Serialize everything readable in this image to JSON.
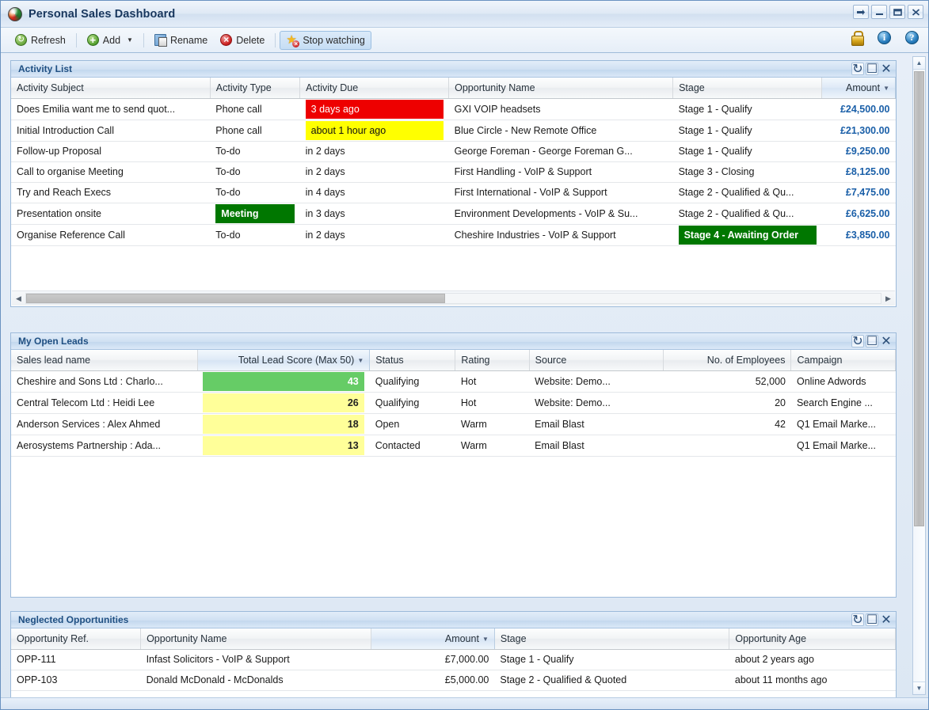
{
  "window": {
    "title": "Personal Sales Dashboard",
    "app_icon": "globe-icon",
    "controls": [
      {
        "name": "restore-down-button",
        "glyph": "⇥"
      },
      {
        "name": "minimize-button",
        "glyph": "─"
      },
      {
        "name": "maximize-button",
        "glyph": "☐"
      },
      {
        "name": "close-button",
        "glyph": "✕"
      }
    ]
  },
  "toolbar": {
    "refresh_label": "Refresh",
    "add_label": "Add",
    "add_caret": "▼",
    "rename_label": "Rename",
    "delete_label": "Delete",
    "stop_watching_label": "Stop watching",
    "right_icons": [
      "lock-icon",
      "info-icon",
      "help-icon"
    ],
    "info_glyph": "i",
    "help_glyph": "?"
  },
  "panel_buttons": {
    "refresh": "↻",
    "maximize": "☐",
    "close": "✕"
  },
  "panels": {
    "activity_list": {
      "title": "Activity List",
      "columns": [
        {
          "label": "Activity Subject",
          "sorted": false,
          "align": "left"
        },
        {
          "label": "Activity Type",
          "sorted": false,
          "align": "left"
        },
        {
          "label": "Activity Due",
          "sorted": false,
          "align": "left"
        },
        {
          "label": "Opportunity Name",
          "sorted": false,
          "align": "left"
        },
        {
          "label": "Stage",
          "sorted": false,
          "align": "left"
        },
        {
          "label": "Amount",
          "sorted": true,
          "align": "right"
        }
      ],
      "rows": [
        {
          "subject": "Does Emilia want me to send quot...",
          "type": "Phone call",
          "type_hl": "none",
          "due": "3 days ago",
          "due_hl": "red",
          "opportunity": "GXI VOIP headsets",
          "stage": "Stage 1 - Qualify",
          "stage_hl": "none",
          "amount": "£24,500.00"
        },
        {
          "subject": "Initial Introduction Call",
          "type": "Phone call",
          "type_hl": "none",
          "due": "about 1 hour ago",
          "due_hl": "yellow",
          "opportunity": "Blue Circle - New Remote Office",
          "stage": "Stage 1 - Qualify",
          "stage_hl": "none",
          "amount": "£21,300.00"
        },
        {
          "subject": "Follow-up Proposal",
          "type": "To-do",
          "type_hl": "none",
          "due": "in 2 days",
          "due_hl": "none",
          "opportunity": "George Foreman - George Foreman G...",
          "stage": "Stage 1 - Qualify",
          "stage_hl": "none",
          "amount": "£9,250.00"
        },
        {
          "subject": "Call to organise Meeting",
          "type": "To-do",
          "type_hl": "none",
          "due": "in 2 days",
          "due_hl": "none",
          "opportunity": "First Handling - VoIP & Support",
          "stage": "Stage 3 - Closing",
          "stage_hl": "none",
          "amount": "£8,125.00"
        },
        {
          "subject": "Try and Reach Execs",
          "type": "To-do",
          "type_hl": "none",
          "due": "in 4 days",
          "due_hl": "none",
          "opportunity": "First International - VoIP & Support",
          "stage": "Stage 2 - Qualified & Qu...",
          "stage_hl": "none",
          "amount": "£7,475.00"
        },
        {
          "subject": "Presentation onsite",
          "type": "Meeting",
          "type_hl": "green",
          "due": "in 3 days",
          "due_hl": "none",
          "opportunity": "Environment Developments - VoIP & Su...",
          "stage": "Stage 2 - Qualified & Qu...",
          "stage_hl": "none",
          "amount": "£6,625.00"
        },
        {
          "subject": "Organise Reference Call",
          "type": "To-do",
          "type_hl": "none",
          "due": "in 2 days",
          "due_hl": "none",
          "opportunity": "Cheshire Industries - VoIP & Support",
          "stage": "Stage 4 - Awaiting Order",
          "stage_hl": "green",
          "amount": "£3,850.00"
        }
      ],
      "hscroll": {
        "left_arrow": "◀",
        "right_arrow": "▶",
        "thumb_percent": 49
      }
    },
    "open_leads": {
      "title": "My Open Leads",
      "columns": [
        {
          "label": "Sales lead name",
          "sorted": false,
          "align": "left"
        },
        {
          "label": "Total Lead Score (Max 50)",
          "sorted": true,
          "align": "right"
        },
        {
          "label": "Status",
          "sorted": false,
          "align": "left"
        },
        {
          "label": "Rating",
          "sorted": false,
          "align": "left"
        },
        {
          "label": "Source",
          "sorted": false,
          "align": "left"
        },
        {
          "label": "No. of Employees",
          "sorted": false,
          "align": "right"
        },
        {
          "label": "Campaign",
          "sorted": false,
          "align": "left"
        }
      ],
      "rows": [
        {
          "name": "Cheshire and Sons Ltd : Charlo...",
          "score": "43",
          "score_hl": "green",
          "status": "Qualifying",
          "rating": "Hot",
          "source": "Website: Demo...",
          "employees": "52,000",
          "campaign": "Online Adwords"
        },
        {
          "name": "Central Telecom Ltd : Heidi Lee",
          "score": "26",
          "score_hl": "yellow",
          "status": "Qualifying",
          "rating": "Hot",
          "source": "Website: Demo...",
          "employees": "20",
          "campaign": "Search Engine ..."
        },
        {
          "name": "Anderson Services : Alex Ahmed",
          "score": "18",
          "score_hl": "yellow",
          "status": "Open",
          "rating": "Warm",
          "source": "Email Blast",
          "employees": "42",
          "campaign": "Q1 Email Marke..."
        },
        {
          "name": "Aerosystems Partnership : Ada...",
          "score": "13",
          "score_hl": "yellow",
          "status": "Contacted",
          "rating": "Warm",
          "source": "Email Blast",
          "employees": "",
          "campaign": "Q1 Email Marke..."
        }
      ]
    },
    "neglected_opportunities": {
      "title": "Neglected Opportunities",
      "columns": [
        {
          "label": "Opportunity Ref.",
          "sorted": false,
          "align": "left"
        },
        {
          "label": "Opportunity Name",
          "sorted": false,
          "align": "left"
        },
        {
          "label": "Amount",
          "sorted": true,
          "align": "right"
        },
        {
          "label": "Stage",
          "sorted": false,
          "align": "left"
        },
        {
          "label": "Opportunity Age",
          "sorted": false,
          "align": "left"
        }
      ],
      "rows": [
        {
          "ref": "OPP-111",
          "name": "Infast Solicitors - VoIP & Support",
          "amount": "£7,000.00",
          "stage": "Stage 1 - Qualify",
          "age": "about 2 years ago"
        },
        {
          "ref": "OPP-103",
          "name": "Donald McDonald - McDonalds",
          "amount": "£5,000.00",
          "stage": "Stage 2 - Qualified & Quoted",
          "age": "about 11 months ago"
        }
      ]
    }
  },
  "scrollbar": {
    "up_arrow": "▲",
    "down_arrow": "▼"
  },
  "colors": {
    "overdue_red": "#EE0000",
    "due_soon_yellow": "#FFFF00",
    "stage_green": "#007700",
    "score_high_green": "#66CC66",
    "score_low_yellow": "#FFFF99",
    "amount_blue": "#1A5FA8",
    "panel_title_blue": "#1F4F82"
  }
}
